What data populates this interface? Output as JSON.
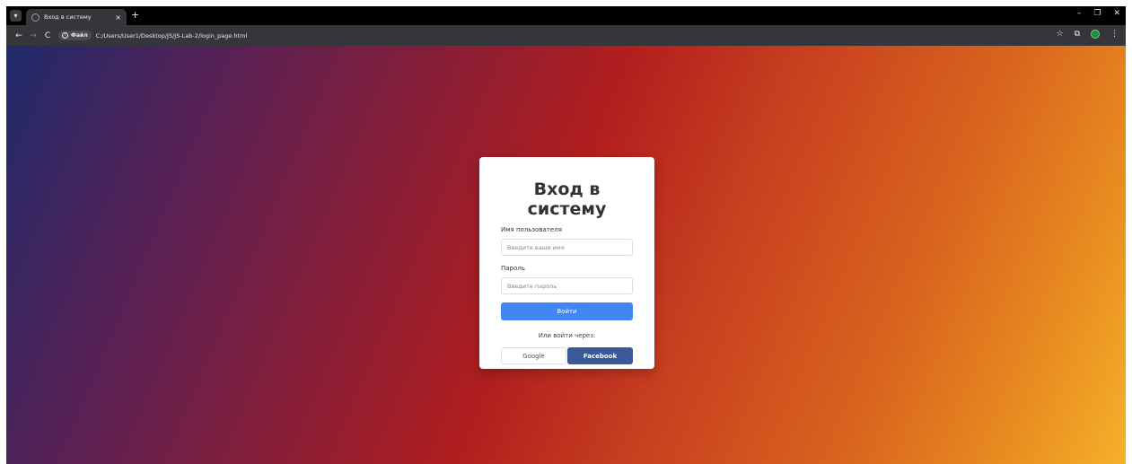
{
  "browser": {
    "tab": {
      "title": "Вход в систему",
      "close": "×"
    },
    "new_tab": "+",
    "window": {
      "minimize": "–",
      "restore": "❐",
      "close": "✕"
    },
    "nav": {
      "back": "←",
      "forward": "→",
      "reload": "C"
    },
    "omnibox": {
      "chip_label": "Файл",
      "url": "C:/Users/User1/Desktop/JS/JS-Lab-2/login_page.html"
    },
    "toolbar_icons": {
      "bookmark": "☆",
      "extensions": "⧉",
      "menu": "⋮"
    }
  },
  "login": {
    "title": "Вход в систему",
    "username_label": "Имя пользователя",
    "username_placeholder": "Введите ваше имя",
    "password_label": "Пароль",
    "password_placeholder": "Введите пароль",
    "submit_label": "Войти",
    "or_text": "Или войти через:",
    "google_label": "Google",
    "facebook_label": "Facebook"
  },
  "colors": {
    "primary_button": "#4285f4",
    "facebook": "#3b5998"
  }
}
